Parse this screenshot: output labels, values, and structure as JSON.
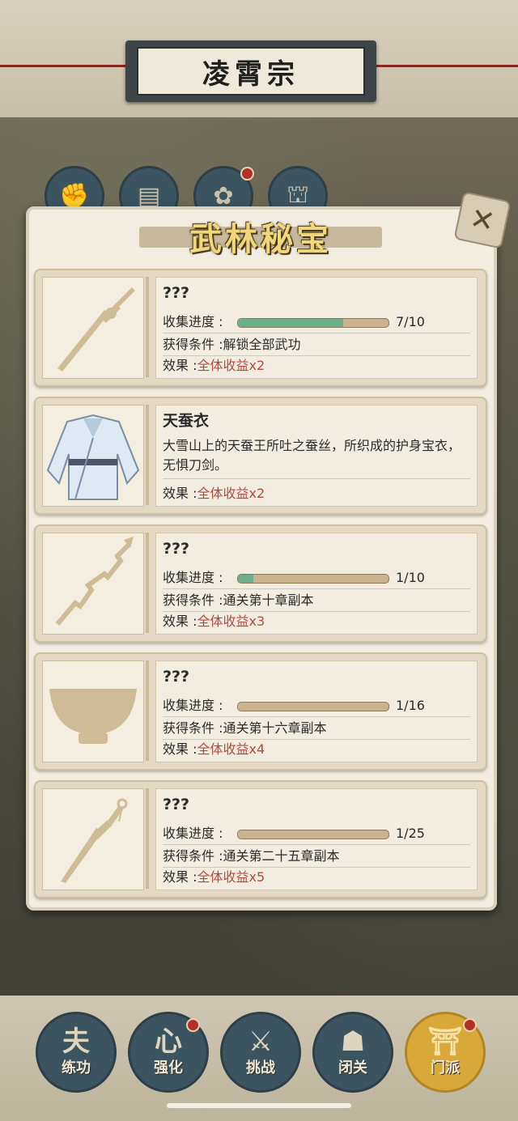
{
  "header": {
    "title": "凌霄宗"
  },
  "top_icons": [
    {
      "name": "fist-icon",
      "glyph": "✊"
    },
    {
      "name": "scroll-icon",
      "glyph": "▤"
    },
    {
      "name": "lotus-icon",
      "glyph": "✿"
    },
    {
      "name": "helmet-icon",
      "glyph": "⛫"
    }
  ],
  "panel": {
    "title": "武林秘宝",
    "close_glyph": "✕",
    "labels": {
      "progress": "收集进度",
      "condition": "获得条件",
      "effect": "效果"
    },
    "items": [
      {
        "name": "???",
        "progress_text": "7/10",
        "progress": 0.7,
        "condition": "解锁全部武功",
        "effect": "全体收益x2",
        "icon": "sword-icon"
      },
      {
        "name": "天蚕衣",
        "description": "大雪山上的天蚕王所吐之蚕丝，所织成的护身宝衣，无惧刀剑。",
        "effect": "全体收益x2",
        "icon": "robe-icon"
      },
      {
        "name": "???",
        "progress_text": "1/10",
        "progress": 0.1,
        "condition": "通关第十章副本",
        "effect": "全体收益x3",
        "icon": "spear-icon"
      },
      {
        "name": "???",
        "progress_text": "1/16",
        "progress": 0.0625,
        "condition": "通关第十六章副本",
        "effect": "全体收益x4",
        "icon": "bowl-icon"
      },
      {
        "name": "???",
        "progress_text": "1/25",
        "progress": 0.04,
        "condition": "通关第二十五章副本",
        "effect": "全体收益x5",
        "icon": "dagger-icon"
      }
    ]
  },
  "bottom_nav": [
    {
      "label": "练功",
      "glyph": "夫",
      "icon": "training-icon",
      "badge": false,
      "active": false
    },
    {
      "label": "强化",
      "glyph": "心",
      "icon": "heart-icon",
      "badge": true,
      "active": false
    },
    {
      "label": "挑战",
      "glyph": "⚔",
      "icon": "crossed-swords-icon",
      "badge": false,
      "active": false
    },
    {
      "label": "闭关",
      "glyph": "☗",
      "icon": "meditation-icon",
      "badge": false,
      "active": false
    },
    {
      "label": "门派",
      "glyph": "⛩",
      "icon": "gate-icon",
      "badge": true,
      "active": true
    }
  ],
  "colors": {
    "accent": "#b14a3c",
    "progress_fill": "#6fae8a",
    "nav_button": "#3c5460",
    "active_nav": "#d9a83a"
  }
}
